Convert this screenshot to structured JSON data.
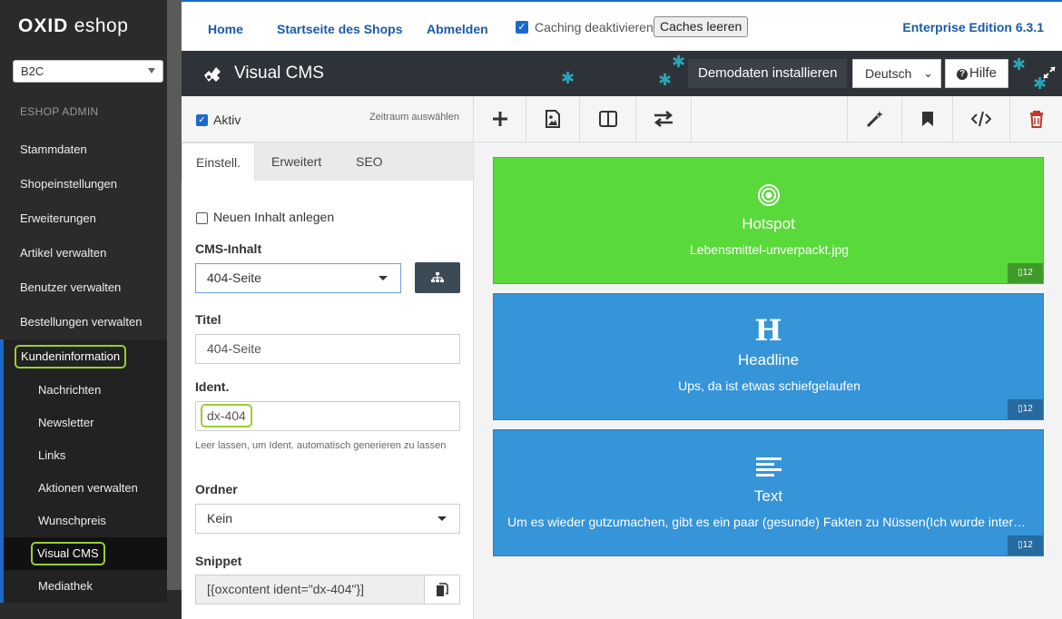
{
  "sidebar": {
    "logo_bold": "OXID",
    "logo_rest": "eshop",
    "shop_select": "B2C",
    "heading": "ESHOP ADMIN",
    "items": [
      {
        "label": "Stammdaten"
      },
      {
        "label": "Shopeinstellungen"
      },
      {
        "label": "Erweiterungen"
      },
      {
        "label": "Artikel verwalten"
      },
      {
        "label": "Benutzer verwalten"
      },
      {
        "label": "Bestellungen verwalten"
      }
    ],
    "group": {
      "label": "Kundeninformation",
      "items": [
        {
          "label": "Nachrichten"
        },
        {
          "label": "Newsletter"
        },
        {
          "label": "Links"
        },
        {
          "label": "Aktionen verwalten"
        },
        {
          "label": "Wunschpreis"
        },
        {
          "label": "Visual CMS"
        },
        {
          "label": "Mediathek"
        }
      ]
    }
  },
  "topbar": {
    "home": "Home",
    "shop_start": "Startseite des Shops",
    "logout": "Abmelden",
    "caching_label": "Caching deaktivieren",
    "clear_caches": "Caches leeren",
    "edition": "Enterprise Edition 6.3.1"
  },
  "vcms": {
    "title": "Visual CMS",
    "demo_button": "Demodaten installieren",
    "language": "Deutsch",
    "help": "Hilfe"
  },
  "panel": {
    "active_label": "Aktiv",
    "timerange": "Zeitraum auswählen",
    "tabs": [
      {
        "label": "Einstell."
      },
      {
        "label": "Erweitert"
      },
      {
        "label": "SEO"
      }
    ],
    "new_content_label": "Neuen Inhalt anlegen",
    "cms_label": "CMS-Inhalt",
    "cms_value": "404-Seite",
    "title_label": "Titel",
    "title_value": "404-Seite",
    "ident_label": "Ident.",
    "ident_value": "dx-404",
    "ident_help": "Leer lassen, um Ident. automatisch generieren zu lassen",
    "folder_label": "Ordner",
    "folder_value": "Kein",
    "snippet_label": "Snippet",
    "snippet_value": "[{oxcontent ident=\"dx-404\"}]"
  },
  "toolbar_icons": [
    "plus-icon",
    "image-icon",
    "columns-icon",
    "swap-icon",
    "magic-wand-icon",
    "bookmark-icon",
    "code-icon",
    "trash-icon"
  ],
  "widgets": [
    {
      "icon": "target-icon",
      "title": "Hotspot",
      "subtitle": "Lebensmittel-unverpackt.jpg",
      "badge": "12",
      "color": "#5ad93a",
      "badge_color": "#3f9a2a"
    },
    {
      "icon": "headline-icon",
      "glyph": "H",
      "title": "Headline",
      "subtitle": "Ups, da ist etwas schiefgelaufen",
      "badge": "12",
      "color": "#3694d8",
      "badge_color": "#266aa0"
    },
    {
      "icon": "text-lines-icon",
      "title": "Text",
      "subtitle": "Um es wieder gutzumachen, gibt es ein paar (gesunde) Fakten zu Nüssen(Ich wurde interviewt, was ich so esse, als ich krank war …)",
      "badge": "12",
      "color": "#3694d8",
      "badge_color": "#266aa0"
    }
  ],
  "colors": {
    "accent": "#1b6ac9",
    "highlight": "#9acd32",
    "header": "#2d3338",
    "puzzle": "#2aa3b6",
    "trash": "#c0392b"
  }
}
